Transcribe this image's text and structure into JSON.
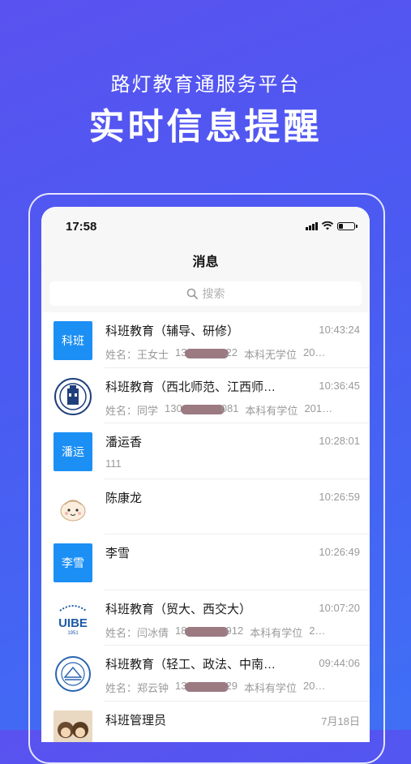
{
  "promo": {
    "subtitle": "路灯教育通服务平台",
    "title": "实时信息提醒"
  },
  "status_bar": {
    "time": "17:58",
    "icons": [
      "signal-icon",
      "wifi-icon",
      "battery-icon"
    ]
  },
  "nav": {
    "title": "消息"
  },
  "search": {
    "placeholder": "搜索",
    "icon": "search-icon"
  },
  "colors": {
    "accent": "#1c8ff5",
    "background_top": "#5a52f0",
    "background_bottom": "#3f6ff5"
  },
  "messages": [
    {
      "name": "科班教育（辅导、研修）",
      "time": "10:43:24",
      "avatar_text": "科班",
      "preview": {
        "a": "姓名：王女士",
        "b1": "13",
        "b2": "22",
        "c": "本科无学位",
        "d": "20…"
      }
    },
    {
      "name": "科班教育（西北师范、江西师…",
      "time": "10:36:45",
      "avatar_icon": "university-emblem-icon",
      "preview": {
        "a": "姓名：同学",
        "b1": "130",
        "b2": "081",
        "c": "本科有学位",
        "d": "201…"
      }
    },
    {
      "name": "潘运香",
      "time": "10:28:01",
      "avatar_text": "潘运",
      "preview_text": "111"
    },
    {
      "name": "陈康龙",
      "time": "10:26:59",
      "avatar_icon": "cartoon-avatar-icon",
      "preview_text": ""
    },
    {
      "name": "李雪",
      "time": "10:26:49",
      "avatar_text": "李雪",
      "preview_text": ""
    },
    {
      "name": "科班教育（贸大、西交大）",
      "time": "10:07:20",
      "avatar_icon": "uibe-logo-icon",
      "preview": {
        "a": "姓名：闫冰倩",
        "b1": "18",
        "b2": "912",
        "c": "本科有学位",
        "d": "2…"
      }
    },
    {
      "name": "科班教育（轻工、政法、中南…",
      "time": "09:44:06",
      "avatar_icon": "university-seal-icon",
      "preview": {
        "a": "姓名：郑云钟",
        "b1": "13",
        "b2": "29",
        "c": "本科有学位",
        "d": "20…"
      }
    },
    {
      "name": "科班管理员",
      "time": "7月18日",
      "avatar_icon": "photo-avatar-icon",
      "preview_text": ""
    }
  ]
}
